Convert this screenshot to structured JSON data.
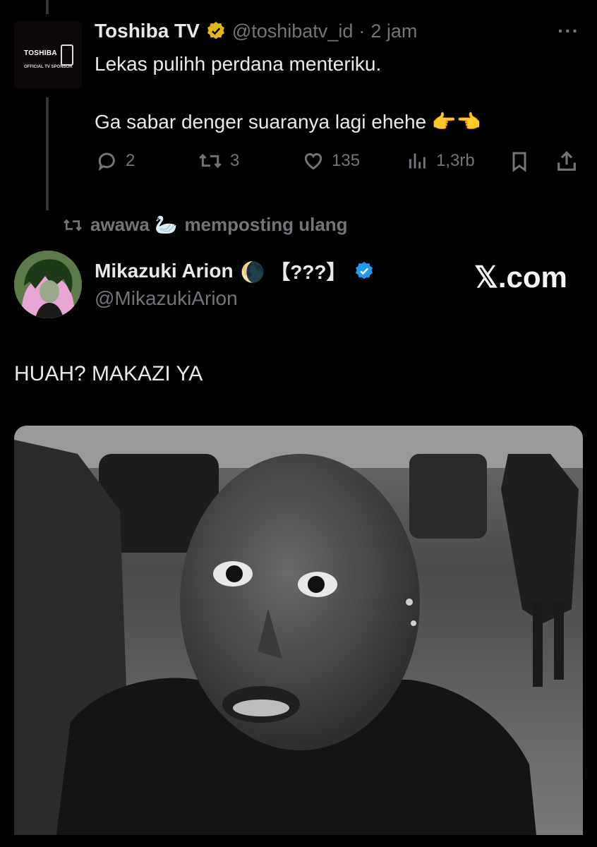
{
  "tweet1": {
    "name": "Toshiba TV",
    "handle": "@toshibatv_id",
    "sep": "·",
    "time": "2 jam",
    "more": "···",
    "avatar_brand": "TOSHIBA",
    "avatar_sub": "OFFICIAL TV SPONSOR",
    "line1": "Lekas pulihh perdana menteriku.",
    "line2": "Ga sabar denger suaranya lagi ehehe 👉👈",
    "replies": "2",
    "reposts": "3",
    "likes": "135",
    "views": "1,3rb"
  },
  "repost_banner": {
    "icon": "repost-icon",
    "text_user": "awawa 🦢",
    "text_action": "memposting ulang"
  },
  "tweet2": {
    "name": "Mikazuki Arion",
    "name_suffix": "🌘 【???】",
    "handle": "@MikazukiArion",
    "watermark": "𝕏.com",
    "body": "HUAH? MAKAZI YA"
  },
  "colors": {
    "background": "#000000",
    "text": "#e7e9ea",
    "muted": "#71767b",
    "verified_gold": "#e2b719",
    "verified_blue": "#1d9bf0"
  }
}
